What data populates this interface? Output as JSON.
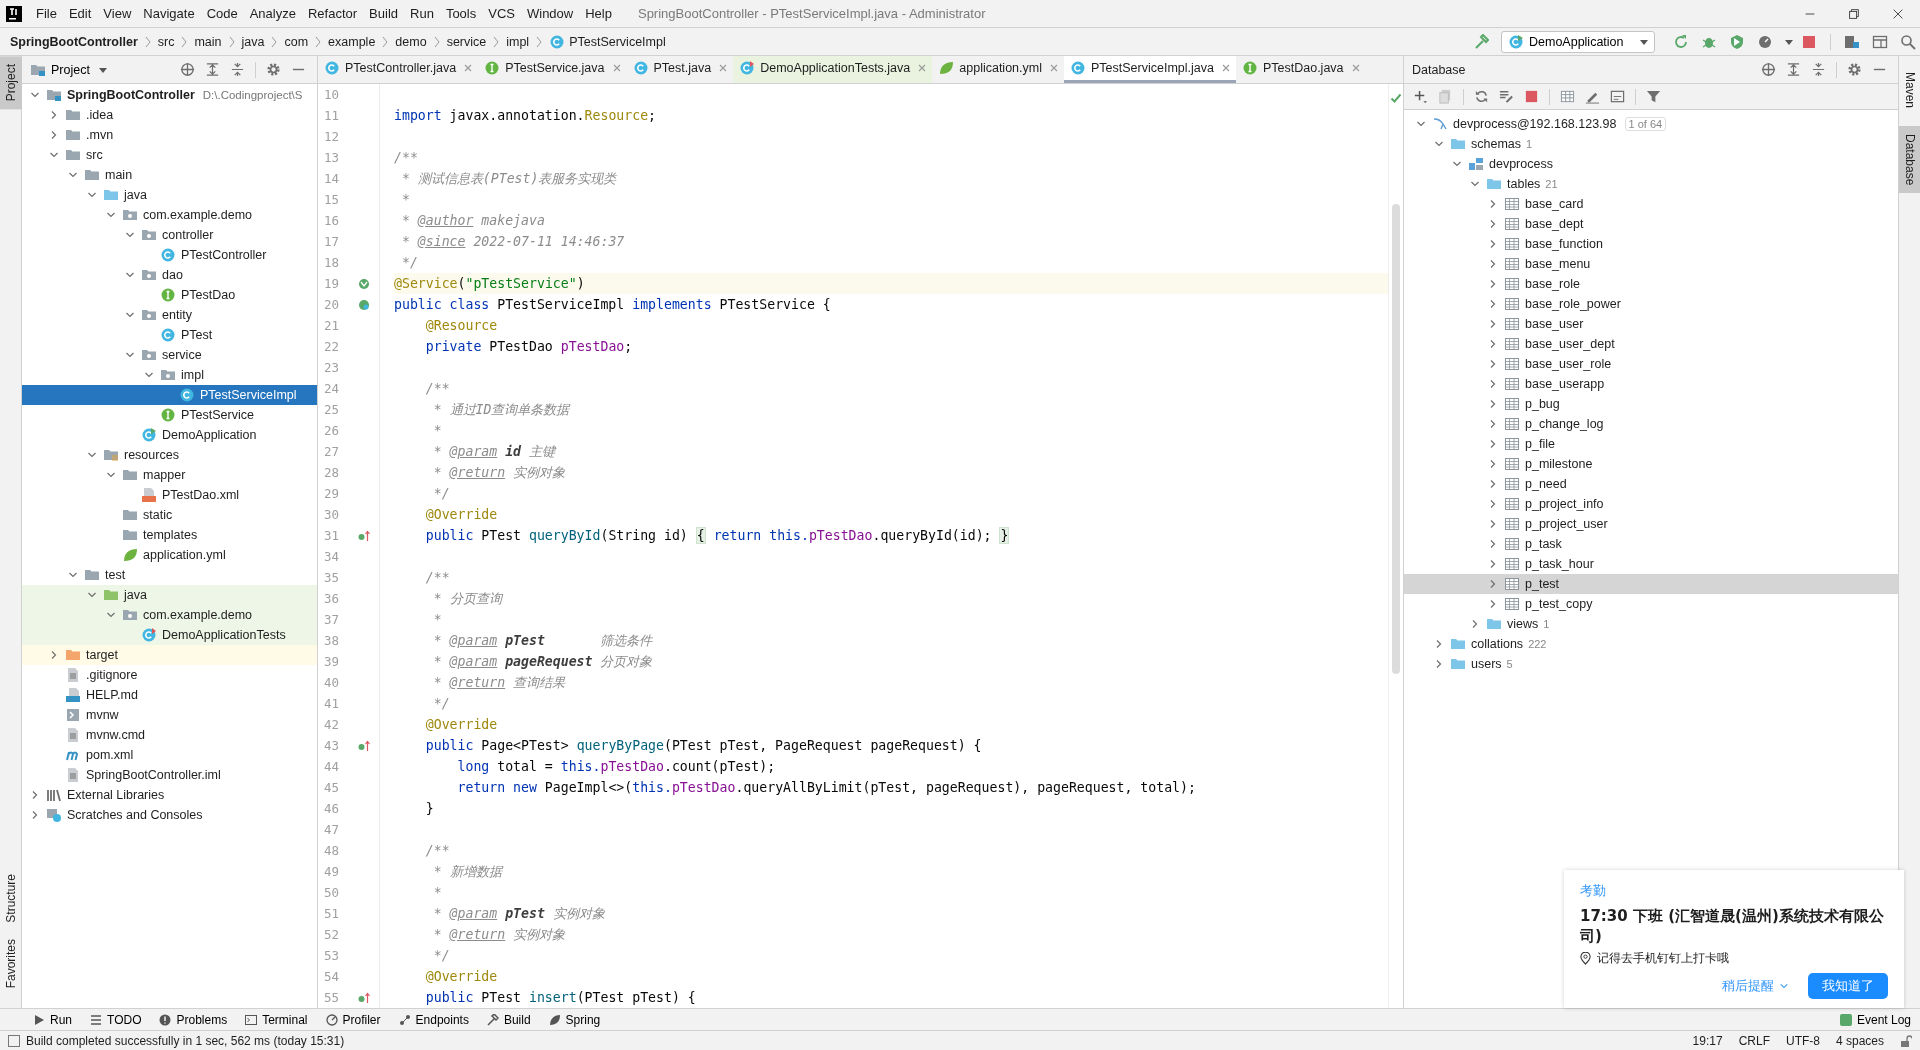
{
  "window": {
    "title": "SpringBootController - PTestServiceImpl.java - Administrator"
  },
  "menu": [
    "File",
    "Edit",
    "View",
    "Navigate",
    "Code",
    "Analyze",
    "Refactor",
    "Build",
    "Run",
    "Tools",
    "VCS",
    "Window",
    "Help"
  ],
  "breadcrumbs": [
    {
      "text": "SpringBootController",
      "kind": "project"
    },
    {
      "text": "src",
      "kind": "folder"
    },
    {
      "text": "main",
      "kind": "folder"
    },
    {
      "text": "java",
      "kind": "folder"
    },
    {
      "text": "com",
      "kind": "folder"
    },
    {
      "text": "example",
      "kind": "folder"
    },
    {
      "text": "demo",
      "kind": "folder"
    },
    {
      "text": "service",
      "kind": "folder"
    },
    {
      "text": "impl",
      "kind": "folder"
    },
    {
      "text": "PTestServiceImpl",
      "kind": "class"
    }
  ],
  "run_config": "DemoApplication",
  "left_stripe": {
    "top": [
      {
        "label": "Project",
        "selected": true
      }
    ],
    "bottom": [
      {
        "label": "Structure",
        "selected": false
      },
      {
        "label": "Favorites",
        "selected": false
      }
    ]
  },
  "right_stripe": [
    {
      "label": "Maven",
      "selected": false
    },
    {
      "label": "Database",
      "selected": true
    }
  ],
  "project_panel": {
    "title": "Project"
  },
  "project_tree": [
    {
      "label": "SpringBootController",
      "path": "D:\\.Codingproject\\S",
      "kind": "module",
      "expanded": true,
      "selected": false,
      "children": [
        {
          "label": ".idea",
          "kind": "folder",
          "expanded": false,
          "selected": false
        },
        {
          "label": ".mvn",
          "kind": "folder",
          "expanded": false,
          "selected": false
        },
        {
          "label": "src",
          "kind": "folder",
          "expanded": true,
          "selected": false,
          "children": [
            {
              "label": "main",
              "kind": "folder",
              "expanded": true,
              "selected": false,
              "children": [
                {
                  "label": "java",
                  "kind": "source",
                  "expanded": true,
                  "selected": false,
                  "children": [
                    {
                      "label": "com.example.demo",
                      "kind": "package",
                      "expanded": true,
                      "selected": false,
                      "children": [
                        {
                          "label": "controller",
                          "kind": "package",
                          "expanded": true,
                          "selected": false,
                          "children": [
                            {
                              "label": "PTestController",
                              "kind": "class",
                              "selected": false
                            }
                          ]
                        },
                        {
                          "label": "dao",
                          "kind": "package",
                          "expanded": true,
                          "selected": false,
                          "children": [
                            {
                              "label": "PTestDao",
                              "kind": "interface",
                              "selected": false
                            }
                          ]
                        },
                        {
                          "label": "entity",
                          "kind": "package",
                          "expanded": true,
                          "selected": false,
                          "children": [
                            {
                              "label": "PTest",
                              "kind": "class",
                              "selected": false
                            }
                          ]
                        },
                        {
                          "label": "service",
                          "kind": "package",
                          "expanded": true,
                          "selected": false,
                          "children": [
                            {
                              "label": "impl",
                              "kind": "package",
                              "expanded": true,
                              "selected": false,
                              "children": [
                                {
                                  "label": "PTestServiceImpl",
                                  "kind": "class",
                                  "selected": true
                                }
                              ]
                            },
                            {
                              "label": "PTestService",
                              "kind": "interface",
                              "selected": false
                            }
                          ]
                        },
                        {
                          "label": "DemoApplication",
                          "kind": "app",
                          "selected": false
                        }
                      ]
                    }
                  ]
                },
                {
                  "label": "resources",
                  "kind": "resources",
                  "expanded": true,
                  "selected": false,
                  "children": [
                    {
                      "label": "mapper",
                      "kind": "folder",
                      "expanded": true,
                      "selected": false,
                      "children": [
                        {
                          "label": "PTestDao.xml",
                          "kind": "xml",
                          "selected": false
                        }
                      ]
                    },
                    {
                      "label": "static",
                      "kind": "folder",
                      "selected": false
                    },
                    {
                      "label": "templates",
                      "kind": "folder",
                      "selected": false
                    },
                    {
                      "label": "application.yml",
                      "kind": "yml",
                      "selected": false
                    }
                  ]
                }
              ]
            },
            {
              "label": "test",
              "kind": "folder",
              "expanded": true,
              "selected": false,
              "children": [
                {
                  "label": "java",
                  "kind": "testsource",
                  "expanded": true,
                  "selected": false,
                  "children": [
                    {
                      "label": "com.example.demo",
                      "kind": "testpackage",
                      "expanded": true,
                      "selected": false,
                      "children": [
                        {
                          "label": "DemoApplicationTests",
                          "kind": "testclass",
                          "selected": false
                        }
                      ]
                    }
                  ]
                }
              ]
            }
          ]
        },
        {
          "label": "target",
          "kind": "excluded",
          "expanded": false,
          "selected": false
        },
        {
          "label": ".gitignore",
          "kind": "file",
          "selected": false
        },
        {
          "label": "HELP.md",
          "kind": "md",
          "selected": false
        },
        {
          "label": "mvnw",
          "kind": "script",
          "selected": false
        },
        {
          "label": "mvnw.cmd",
          "kind": "file",
          "selected": false
        },
        {
          "label": "pom.xml",
          "kind": "maven",
          "selected": false
        },
        {
          "label": "SpringBootController.iml",
          "kind": "file",
          "selected": false
        }
      ]
    },
    {
      "label": "External Libraries",
      "kind": "libraries",
      "expanded": false,
      "selected": false
    },
    {
      "label": "Scratches and Consoles",
      "kind": "scratches",
      "expanded": false,
      "selected": false
    }
  ],
  "tabs": [
    {
      "label": "PTestController.java",
      "kind": "class",
      "selected": false
    },
    {
      "label": "PTestService.java",
      "kind": "interface",
      "selected": false
    },
    {
      "label": "PTest.java",
      "kind": "class",
      "selected": false
    },
    {
      "label": "DemoApplicationTests.java",
      "kind": "testclass",
      "selected": false
    },
    {
      "label": "application.yml",
      "kind": "yml",
      "selected": false
    },
    {
      "label": "PTestServiceImpl.java",
      "kind": "class",
      "selected": true
    },
    {
      "label": "PTestDao.java",
      "kind": "interface",
      "selected": false
    }
  ],
  "code": [
    {
      "number": "10",
      "current": false
    },
    {
      "number": "11",
      "current": false,
      "tokens": [
        {
          "kind": "kw",
          "text": "import"
        },
        {
          "kind": "plain",
          "text": " javax.annotation."
        },
        {
          "kind": "ann",
          "text": "Resource"
        },
        {
          "kind": "plain",
          "text": ";"
        }
      ]
    },
    {
      "number": "12",
      "current": false
    },
    {
      "number": "13",
      "current": false,
      "tokens": [
        {
          "kind": "doc",
          "text": "/**"
        }
      ]
    },
    {
      "number": "14",
      "current": false,
      "tokens": [
        {
          "kind": "doc",
          "text": " * 测试信息表(PTest)表服务实现类"
        }
      ]
    },
    {
      "number": "15",
      "current": false,
      "tokens": [
        {
          "kind": "doc",
          "text": " *"
        }
      ]
    },
    {
      "number": "16",
      "current": false,
      "tokens": [
        {
          "kind": "doc",
          "text": " * "
        },
        {
          "kind": "tag",
          "text": "@author"
        },
        {
          "kind": "doc",
          "text": " makejava"
        }
      ]
    },
    {
      "number": "17",
      "current": false,
      "tokens": [
        {
          "kind": "doc",
          "text": " * "
        },
        {
          "kind": "tag",
          "text": "@since"
        },
        {
          "kind": "doc",
          "text": " 2022-07-11 14:46:37"
        }
      ]
    },
    {
      "number": "18",
      "current": false,
      "tokens": [
        {
          "kind": "doc",
          "text": " */"
        }
      ]
    },
    {
      "number": "19",
      "current": true,
      "kind": "bean",
      "tokens": [
        {
          "kind": "ann",
          "text": "@Service"
        },
        {
          "kind": "plain",
          "text": "("
        },
        {
          "kind": "str",
          "text": "\"pTestService\""
        },
        {
          "kind": "plain",
          "text": ")"
        }
      ]
    },
    {
      "number": "20",
      "current": false,
      "kind": "bean-class",
      "tokens": [
        {
          "kind": "kw",
          "text": "public class"
        },
        {
          "kind": "plain",
          "text": " PTestServiceImpl "
        },
        {
          "kind": "kw",
          "text": "implements"
        },
        {
          "kind": "plain",
          "text": " PTestService {"
        }
      ]
    },
    {
      "number": "21",
      "current": false,
      "tokens": [
        {
          "kind": "ann",
          "text": "    @Resource"
        }
      ]
    },
    {
      "number": "22",
      "current": false,
      "tokens": [
        {
          "kind": "kw",
          "text": "    private"
        },
        {
          "kind": "plain",
          "text": " PTestDao "
        },
        {
          "kind": "field",
          "text": "pTestDao"
        },
        {
          "kind": "plain",
          "text": ";"
        }
      ]
    },
    {
      "number": "23",
      "current": false
    },
    {
      "number": "24",
      "current": false,
      "tokens": [
        {
          "kind": "doc",
          "text": "    /**"
        }
      ]
    },
    {
      "number": "25",
      "current": false,
      "tokens": [
        {
          "kind": "doc",
          "text": "     * 通过ID查询单条数据"
        }
      ]
    },
    {
      "number": "26",
      "current": false,
      "tokens": [
        {
          "kind": "doc",
          "text": "     *"
        }
      ]
    },
    {
      "number": "27",
      "current": false,
      "tokens": [
        {
          "kind": "doc",
          "text": "     * "
        },
        {
          "kind": "tag",
          "text": "@param"
        },
        {
          "kind": "docname",
          "text": " id"
        },
        {
          "kind": "doc",
          "text": " 主键"
        }
      ]
    },
    {
      "number": "28",
      "current": false,
      "tokens": [
        {
          "kind": "doc",
          "text": "     * "
        },
        {
          "kind": "tag",
          "text": "@return"
        },
        {
          "kind": "doc",
          "text": " 实例对象"
        }
      ]
    },
    {
      "number": "29",
      "current": false,
      "tokens": [
        {
          "kind": "doc",
          "text": "     */"
        }
      ]
    },
    {
      "number": "30",
      "current": false,
      "tokens": [
        {
          "kind": "ann",
          "text": "    @Override"
        }
      ]
    },
    {
      "number": "31",
      "current": false,
      "kind": "override",
      "tokens": [
        {
          "kind": "kw",
          "text": "    public"
        },
        {
          "kind": "plain",
          "text": " PTest "
        },
        {
          "kind": "fn",
          "text": "queryById"
        },
        {
          "kind": "plain",
          "text": "(String id) "
        },
        {
          "kind": "fold",
          "text": "{"
        },
        {
          "kind": "kw",
          "text": " return this."
        },
        {
          "kind": "field",
          "text": "pTestDao"
        },
        {
          "kind": "plain",
          "text": ".queryById(id); "
        },
        {
          "kind": "fold",
          "text": "}"
        }
      ]
    },
    {
      "number": "34",
      "current": false
    },
    {
      "number": "35",
      "current": false,
      "tokens": [
        {
          "kind": "doc",
          "text": "    /**"
        }
      ]
    },
    {
      "number": "36",
      "current": false,
      "tokens": [
        {
          "kind": "doc",
          "text": "     * 分页查询"
        }
      ]
    },
    {
      "number": "37",
      "current": false,
      "tokens": [
        {
          "kind": "doc",
          "text": "     *"
        }
      ]
    },
    {
      "number": "38",
      "current": false,
      "tokens": [
        {
          "kind": "doc",
          "text": "     * "
        },
        {
          "kind": "tag",
          "text": "@param"
        },
        {
          "kind": "docname",
          "text": " pTest"
        },
        {
          "kind": "doc",
          "text": "       筛选条件"
        }
      ]
    },
    {
      "number": "39",
      "current": false,
      "tokens": [
        {
          "kind": "doc",
          "text": "     * "
        },
        {
          "kind": "tag",
          "text": "@param"
        },
        {
          "kind": "docname",
          "text": " pageRequest"
        },
        {
          "kind": "doc",
          "text": " 分页对象"
        }
      ]
    },
    {
      "number": "40",
      "current": false,
      "tokens": [
        {
          "kind": "doc",
          "text": "     * "
        },
        {
          "kind": "tag",
          "text": "@return"
        },
        {
          "kind": "doc",
          "text": " 查询结果"
        }
      ]
    },
    {
      "number": "41",
      "current": false,
      "tokens": [
        {
          "kind": "doc",
          "text": "     */"
        }
      ]
    },
    {
      "number": "42",
      "current": false,
      "tokens": [
        {
          "kind": "ann",
          "text": "    @Override"
        }
      ]
    },
    {
      "number": "43",
      "current": false,
      "kind": "override",
      "tokens": [
        {
          "kind": "kw",
          "text": "    public"
        },
        {
          "kind": "plain",
          "text": " Page<PTest> "
        },
        {
          "kind": "fn",
          "text": "queryByPage"
        },
        {
          "kind": "plain",
          "text": "(PTest pTest, PageRequest pageRequest) {"
        }
      ]
    },
    {
      "number": "44",
      "current": false,
      "tokens": [
        {
          "kind": "kw",
          "text": "        long"
        },
        {
          "kind": "plain",
          "text": " total = "
        },
        {
          "kind": "kw",
          "text": "this."
        },
        {
          "kind": "field",
          "text": "pTestDao"
        },
        {
          "kind": "plain",
          "text": ".count(pTest);"
        }
      ]
    },
    {
      "number": "45",
      "current": false,
      "tokens": [
        {
          "kind": "kw",
          "text": "        return new"
        },
        {
          "kind": "plain",
          "text": " PageImpl<>("
        },
        {
          "kind": "kw",
          "text": "this."
        },
        {
          "kind": "field",
          "text": "pTestDao"
        },
        {
          "kind": "plain",
          "text": ".queryAllByLimit(pTest, pageRequest), pageRequest, total);"
        }
      ]
    },
    {
      "number": "46",
      "current": false,
      "tokens": [
        {
          "kind": "plain",
          "text": "    }"
        }
      ]
    },
    {
      "number": "47",
      "current": false
    },
    {
      "number": "48",
      "current": false,
      "tokens": [
        {
          "kind": "doc",
          "text": "    /**"
        }
      ]
    },
    {
      "number": "49",
      "current": false,
      "tokens": [
        {
          "kind": "doc",
          "text": "     * 新增数据"
        }
      ]
    },
    {
      "number": "50",
      "current": false,
      "tokens": [
        {
          "kind": "doc",
          "text": "     *"
        }
      ]
    },
    {
      "number": "51",
      "current": false,
      "tokens": [
        {
          "kind": "doc",
          "text": "     * "
        },
        {
          "kind": "tag",
          "text": "@param"
        },
        {
          "kind": "docname",
          "text": " pTest"
        },
        {
          "kind": "doc",
          "text": " 实例对象"
        }
      ]
    },
    {
      "number": "52",
      "current": false,
      "tokens": [
        {
          "kind": "doc",
          "text": "     * "
        },
        {
          "kind": "tag",
          "text": "@return"
        },
        {
          "kind": "doc",
          "text": " 实例对象"
        }
      ]
    },
    {
      "number": "53",
      "current": false,
      "tokens": [
        {
          "kind": "doc",
          "text": "     */"
        }
      ]
    },
    {
      "number": "54",
      "current": false,
      "tokens": [
        {
          "kind": "ann",
          "text": "    @Override"
        }
      ]
    },
    {
      "number": "55",
      "current": false,
      "kind": "override",
      "tokens": [
        {
          "kind": "kw",
          "text": "    public"
        },
        {
          "kind": "plain",
          "text": " PTest "
        },
        {
          "kind": "fn",
          "text": "insert"
        },
        {
          "kind": "plain",
          "text": "(PTest pTest) {"
        }
      ]
    }
  ],
  "database_panel": {
    "title": "Database"
  },
  "database_tree": [
    {
      "label": "devprocess@192.168.123.98",
      "badge": "1 of 64",
      "kind": "connection",
      "expanded": true,
      "selected": false,
      "children": [
        {
          "label": "schemas",
          "count": "1",
          "kind": "folder",
          "expanded": true,
          "selected": false,
          "children": [
            {
              "label": "devprocess",
              "kind": "schema",
              "expanded": true,
              "selected": false,
              "children": [
                {
                  "label": "tables",
                  "count": "21",
                  "kind": "folder",
                  "expanded": true,
                  "selected": false,
                  "children": [
                    {
                      "label": "base_card",
                      "kind": "table",
                      "expanded": false,
                      "selected": false
                    },
                    {
                      "label": "base_dept",
                      "kind": "table",
                      "expanded": false,
                      "selected": false
                    },
                    {
                      "label": "base_function",
                      "kind": "table",
                      "expanded": false,
                      "selected": false
                    },
                    {
                      "label": "base_menu",
                      "kind": "table",
                      "expanded": false,
                      "selected": false
                    },
                    {
                      "label": "base_role",
                      "kind": "table",
                      "expanded": false,
                      "selected": false
                    },
                    {
                      "label": "base_role_power",
                      "kind": "table",
                      "expanded": false,
                      "selected": false
                    },
                    {
                      "label": "base_user",
                      "kind": "table",
                      "expanded": false,
                      "selected": false
                    },
                    {
                      "label": "base_user_dept",
                      "kind": "table",
                      "expanded": false,
                      "selected": false
                    },
                    {
                      "label": "base_user_role",
                      "kind": "table",
                      "expanded": false,
                      "selected": false
                    },
                    {
                      "label": "base_userapp",
                      "kind": "table",
                      "expanded": false,
                      "selected": false
                    },
                    {
                      "label": "p_bug",
                      "kind": "table",
                      "expanded": false,
                      "selected": false
                    },
                    {
                      "label": "p_change_log",
                      "kind": "table",
                      "expanded": false,
                      "selected": false
                    },
                    {
                      "label": "p_file",
                      "kind": "table",
                      "expanded": false,
                      "selected": false
                    },
                    {
                      "label": "p_milestone",
                      "kind": "table",
                      "expanded": false,
                      "selected": false
                    },
                    {
                      "label": "p_need",
                      "kind": "table",
                      "expanded": false,
                      "selected": false
                    },
                    {
                      "label": "p_project_info",
                      "kind": "table",
                      "expanded": false,
                      "selected": false
                    },
                    {
                      "label": "p_project_user",
                      "kind": "table",
                      "expanded": false,
                      "selected": false
                    },
                    {
                      "label": "p_task",
                      "kind": "table",
                      "expanded": false,
                      "selected": false
                    },
                    {
                      "label": "p_task_hour",
                      "kind": "table",
                      "expanded": false,
                      "selected": false
                    },
                    {
                      "label": "p_test",
                      "kind": "table",
                      "expanded": false,
                      "selected": true
                    },
                    {
                      "label": "p_test_copy",
                      "kind": "table",
                      "expanded": false,
                      "selected": false
                    }
                  ]
                },
                {
                  "label": "views",
                  "count": "1",
                  "kind": "folder",
                  "expanded": false,
                  "selected": false
                }
              ]
            }
          ]
        },
        {
          "label": "collations",
          "count": "222",
          "kind": "folder",
          "expanded": false,
          "selected": false
        },
        {
          "label": "users",
          "count": "5",
          "kind": "folder",
          "expanded": false,
          "selected": false
        }
      ]
    }
  ],
  "tool_buttons": [
    "Run",
    "TODO",
    "Problems",
    "Terminal",
    "Profiler",
    "Endpoints",
    "Build",
    "Spring"
  ],
  "event_log": "Event Log",
  "status_bar": {
    "message": "Build completed successfully in 1 sec, 562 ms (today 15:31)",
    "items": [
      "19:17",
      "CRLF",
      "UTF-8",
      "4 spaces"
    ]
  },
  "notification": {
    "app": "考勤",
    "title": "17:30 下班 (汇智道晟(温州)系统技术有限公司)",
    "note": "记得去手机钉钉上打卡哦",
    "snooze": "稍后提醒",
    "confirm": "我知道了"
  }
}
